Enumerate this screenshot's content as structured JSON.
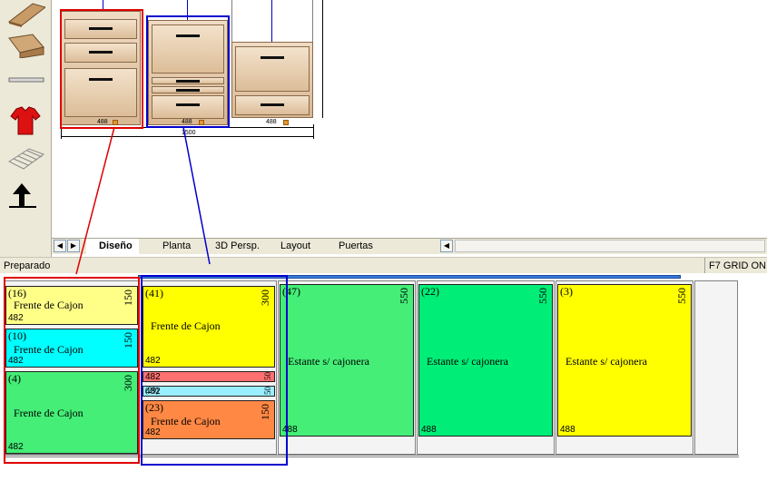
{
  "tabs": [
    "Diseño",
    "Planta",
    "3D Persp.",
    "Layout",
    "Puertas"
  ],
  "nav": {
    "prev": "◀",
    "next": "▶",
    "scroll_left": "◀"
  },
  "status": {
    "left": "Preparado",
    "right": "F7 GRID ON"
  },
  "design": {
    "dim_left": "488",
    "dim_mid": "488",
    "dim_right": "488",
    "dim_total": "1500"
  },
  "cells": [
    {
      "num": "(16)",
      "label": "Frente de Cajon",
      "width": "482",
      "height": "150",
      "color": "#ffff88"
    },
    {
      "num": "(10)",
      "label": "Frente de Cajon",
      "width": "482",
      "height": "150",
      "color": "#00ffff"
    },
    {
      "num": "(4)",
      "label": "Frente de Cajon",
      "width": "482",
      "height": "300",
      "color": "#44ee77"
    },
    {
      "num": "(41)",
      "label": "Frente de Cajon",
      "width": "482",
      "height": "300",
      "color": "#ffff00"
    },
    {
      "num": "",
      "label": "",
      "width": "482",
      "height": "50",
      "color": "#ff7070"
    },
    {
      "num": "(29)",
      "label": "",
      "width": "482",
      "height": "50",
      "color": "#99eeff"
    },
    {
      "num": "(23)",
      "label": "Frente de Cajon",
      "width": "482",
      "height": "150",
      "color": "#ff8844"
    },
    {
      "num": "(47)",
      "label": "Estante s/ cajonera",
      "width": "488",
      "height": "550",
      "color": "#44ee77"
    },
    {
      "num": "(22)",
      "label": "Estante s/ cajonera",
      "width": "488",
      "height": "550",
      "color": "#00ee77"
    },
    {
      "num": "(3)",
      "label": "Estante s/ cajonera",
      "width": "488",
      "height": "550",
      "color": "#ffff00"
    }
  ],
  "colors": {
    "accent_red": "#e00000",
    "accent_blue": "#0000cc",
    "ui_face": "#ece9d8"
  }
}
